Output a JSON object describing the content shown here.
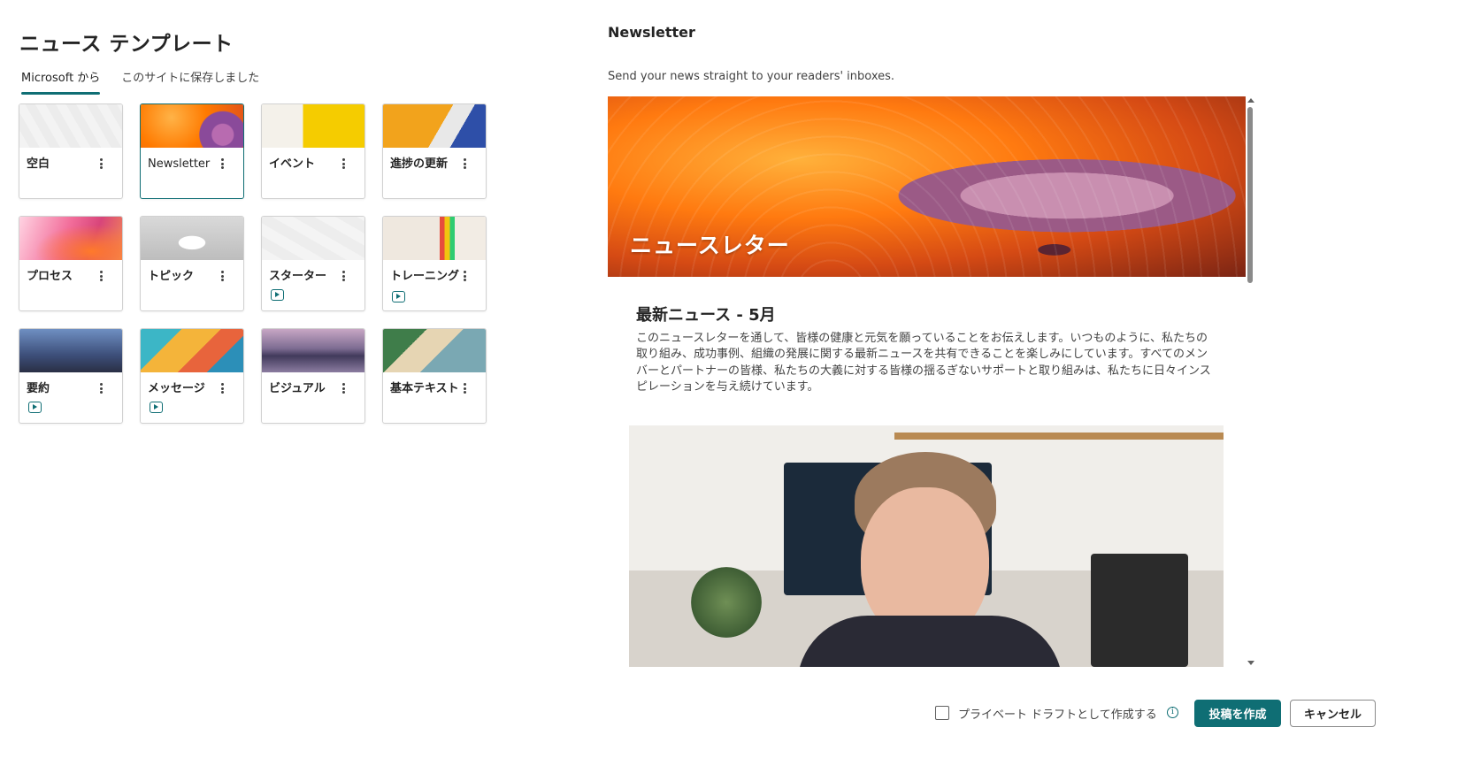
{
  "page_title": "ニュース テンプレート",
  "tabs": [
    {
      "label": "Microsoft から",
      "active": true
    },
    {
      "label": "このサイトに保存しました",
      "active": false
    }
  ],
  "templates": [
    {
      "label": "空白",
      "thumb": "blank",
      "video": false,
      "selected": false
    },
    {
      "label": "Newsletter",
      "thumb": "newsletter",
      "video": false,
      "selected": true
    },
    {
      "label": "イベント",
      "thumb": "event",
      "video": false,
      "selected": false
    },
    {
      "label": "進捗の更新",
      "thumb": "progress",
      "video": false,
      "selected": false
    },
    {
      "label": "プロセス",
      "thumb": "process",
      "video": false,
      "selected": false
    },
    {
      "label": "トピック",
      "thumb": "topic",
      "video": false,
      "selected": false
    },
    {
      "label": "スターター",
      "thumb": "starter",
      "video": true,
      "selected": false
    },
    {
      "label": "トレーニング",
      "thumb": "training",
      "video": true,
      "selected": false
    },
    {
      "label": "要約",
      "thumb": "summary",
      "video": true,
      "selected": false
    },
    {
      "label": "メッセージ",
      "thumb": "message",
      "video": true,
      "selected": false
    },
    {
      "label": "ビジュアル",
      "thumb": "visual",
      "video": false,
      "selected": false
    },
    {
      "label": "基本テキスト",
      "thumb": "basic",
      "video": false,
      "selected": false
    }
  ],
  "preview": {
    "title": "Newsletter",
    "description": "Send your news straight to your readers' inboxes.",
    "hero_title": "ニュースレター",
    "article_heading": "最新ニュース - 5月",
    "article_body": "このニュースレターを通して、皆様の健康と元気を願っていることをお伝えします。いつものように、私たちの取り組み、成功事例、組織の発展に関する最新ニュースを共有できることを楽しみにしています。すべてのメンバーとパートナーの皆様、私たちの大義に対する皆様の揺るぎないサポートと取り組みは、私たちに日々インスピレーションを与え続けています。"
  },
  "footer": {
    "private_draft_label": "プライベート ドラフトとして作成する",
    "private_draft_checked": false,
    "info_icon": "info-icon",
    "create_label": "投稿を作成",
    "cancel_label": "キャンセル"
  },
  "colors": {
    "accent": "#0f6e74"
  }
}
